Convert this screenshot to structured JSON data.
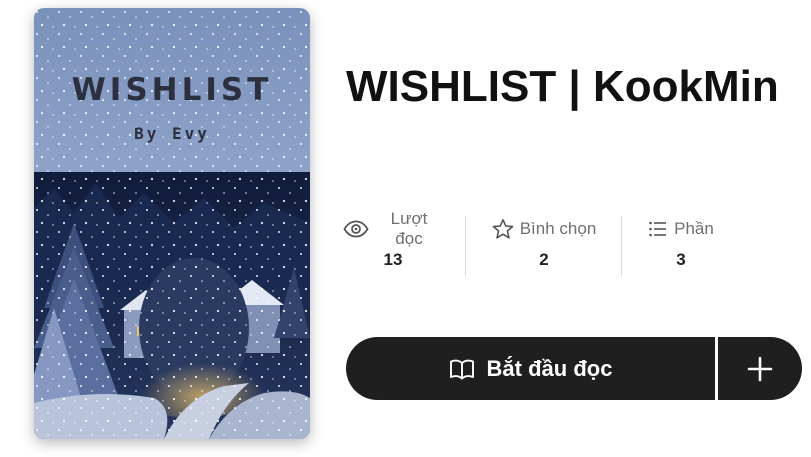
{
  "cover": {
    "title": "WISHLIST",
    "author": "By Evy"
  },
  "story": {
    "title": "WISHLIST | KookMin"
  },
  "stats": [
    {
      "icon": "eye-icon",
      "label": "Lượt đọc",
      "value": "13"
    },
    {
      "icon": "star-icon",
      "label": "Bình chọn",
      "value": "2"
    },
    {
      "icon": "list-icon",
      "label": "Phần",
      "value": "3"
    }
  ],
  "actions": {
    "read_label": "Bắt đầu đọc",
    "read_icon": "book-open-icon",
    "add_icon": "plus-icon"
  },
  "colors": {
    "button": "#1f1f1f",
    "cover_sky": "#7f96bf",
    "cover_night": "#1a2649"
  }
}
